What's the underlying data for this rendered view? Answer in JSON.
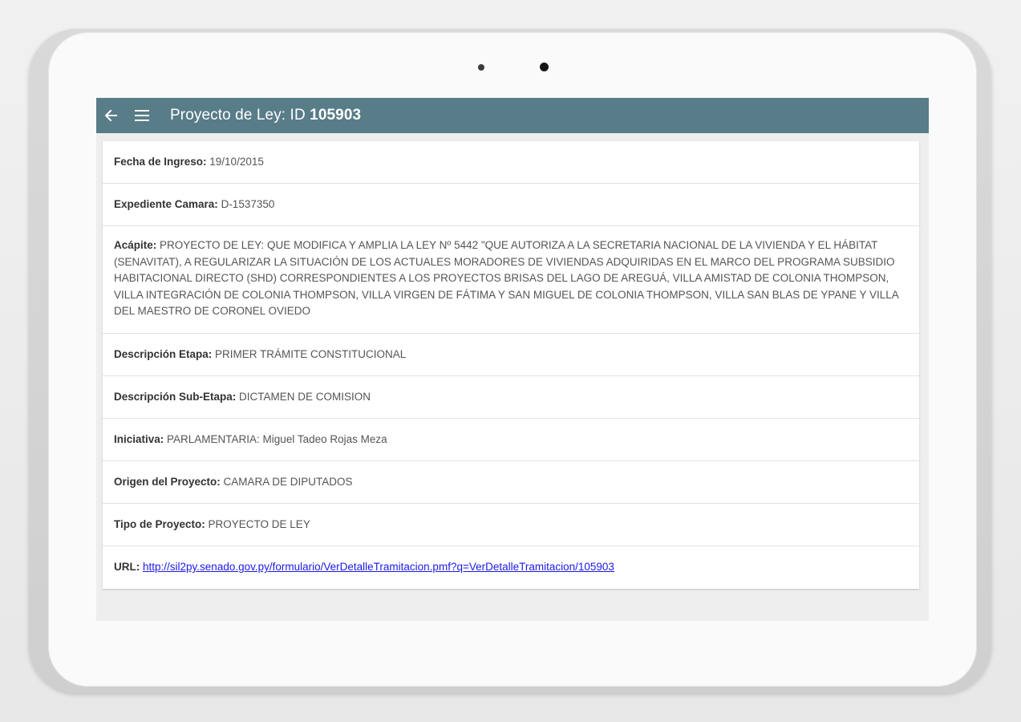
{
  "appbar": {
    "title_prefix": "Proyecto de Ley: ID ",
    "title_id": "105903",
    "back_icon": "arrow-left-icon",
    "menu_icon": "hamburger-menu-icon",
    "color": "#587c88"
  },
  "fields": [
    {
      "label": "Fecha de Ingreso:",
      "value": " 19/10/2015"
    },
    {
      "label": "Expediente Camara:",
      "value": " D-1537350"
    },
    {
      "label": "Acápite:",
      "value": " PROYECTO DE LEY: QUE MODIFICA Y AMPLIA LA LEY Nº 5442 \"QUE AUTORIZA A LA SECRETARIA NACIONAL DE LA VIVIENDA Y EL HÁBITAT (SENAVITAT), A REGULARIZAR LA SITUACIÓN DE LOS ACTUALES MORADORES DE VIVIENDAS ADQUIRIDAS EN EL MARCO DEL PROGRAMA SUBSIDIO HABITACIONAL DIRECTO (SHD) CORRESPONDIENTES A LOS PROYECTOS BRISAS DEL LAGO DE AREGUÁ, VILLA AMISTAD DE COLONIA THOMPSON, VILLA INTEGRACIÓN DE COLONIA THOMPSON, VILLA VIRGEN DE FÁTIMA Y SAN MIGUEL DE COLONIA THOMPSON, VILLA SAN BLAS DE YPANE Y VILLA DEL MAESTRO DE CORONEL OVIEDO"
    },
    {
      "label": "Descripción Etapa:",
      "value": " PRIMER TRÁMITE CONSTITUCIONAL"
    },
    {
      "label": "Descripción Sub-Etapa:",
      "value": " DICTAMEN DE COMISION"
    },
    {
      "label": "Iniciativa:",
      "value": " PARLAMENTARIA: Miguel Tadeo Rojas Meza"
    },
    {
      "label": "Origen del Proyecto:",
      "value": " CAMARA DE DIPUTADOS"
    },
    {
      "label": "Tipo de Proyecto:",
      "value": " PROYECTO DE LEY"
    }
  ],
  "url": {
    "label": "URL:",
    "link": "http://sil2py.senado.gov.py/formulario/VerDetalleTramitacion.pmf?q=VerDetalleTramitacion/105903"
  }
}
